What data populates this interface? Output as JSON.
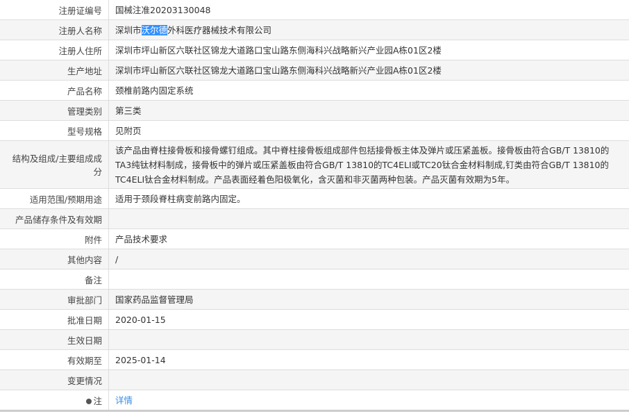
{
  "rows": [
    {
      "label": "注册证编号",
      "value": "国械注准20203130048"
    },
    {
      "label": "注册人名称",
      "value_pre": "深圳市",
      "value_selected": "沃尔德",
      "value_post": "外科医疗器械技术有限公司"
    },
    {
      "label": "注册人住所",
      "value": "深圳市坪山新区六联社区锦龙大道路口宝山路东侧海科兴战略新兴产业园A栋01区2楼"
    },
    {
      "label": "生产地址",
      "value": "深圳市坪山新区六联社区锦龙大道路口宝山路东侧海科兴战略新兴产业园A栋01区2楼"
    },
    {
      "label": "产品名称",
      "value": "颈椎前路内固定系统"
    },
    {
      "label": "管理类别",
      "value": "第三类"
    },
    {
      "label": "型号规格",
      "value": "见附页"
    },
    {
      "label": "结构及组成/主要组成成分",
      "value": "该产品由脊柱接骨板和接骨螺钉组成。其中脊柱接骨板组成部件包括接骨板主体及弹片或压紧盖板。接骨板由符合GB/T 13810的TA3纯钛材料制成，接骨板中的弹片或压紧盖板由符合GB/T 13810的TC4ELI或TC20钛合金材料制成,钉类由符合GB/T 13810的TC4ELI钛合金材料制成。产品表面经着色阳极氧化，含灭菌和非灭菌两种包装。产品灭菌有效期为5年。"
    },
    {
      "label": "适用范围/预期用途",
      "value": "适用于颈段脊柱病变前路内固定。"
    },
    {
      "label": "产品储存条件及有效期",
      "value": ""
    },
    {
      "label": "附件",
      "value": "产品技术要求"
    },
    {
      "label": "其他内容",
      "value": "/"
    },
    {
      "label": "备注",
      "value": ""
    },
    {
      "label": "审批部门",
      "value": "国家药品监督管理局"
    },
    {
      "label": "批准日期",
      "value": "2020-01-15"
    },
    {
      "label": "生效日期",
      "value": ""
    },
    {
      "label": "有效期至",
      "value": "2025-01-14"
    },
    {
      "label": "变更情况",
      "value": ""
    },
    {
      "label": "注",
      "icon": "lightbulb-icon",
      "value": "详情"
    }
  ],
  "colors": {
    "link": "#3a8ee6",
    "selection": "#3390ff"
  }
}
